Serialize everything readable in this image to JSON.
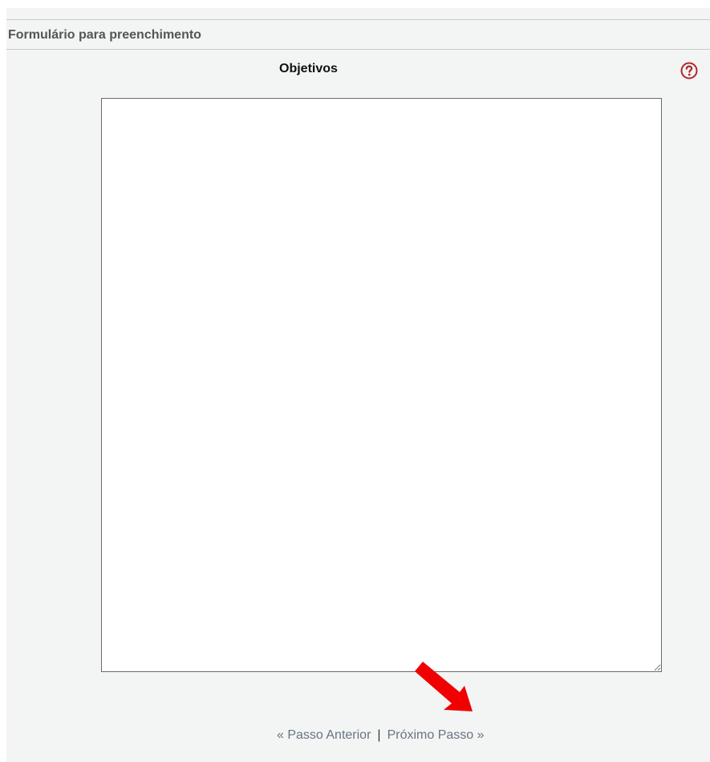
{
  "form": {
    "heading": "Formulário para preenchimento",
    "field_label": "Objetivos",
    "textarea_value": ""
  },
  "navigation": {
    "previous_label": "« Passo Anterior",
    "separator": "|",
    "next_label": "Próximo Passo »"
  },
  "icons": {
    "help": "question-circle-icon",
    "arrow": "red-arrow-down-right-icon"
  },
  "colors": {
    "panel_background": "#f3f4f4",
    "help_icon": "#b3242a",
    "annotation_arrow": "#f00000",
    "link": "#687582"
  }
}
